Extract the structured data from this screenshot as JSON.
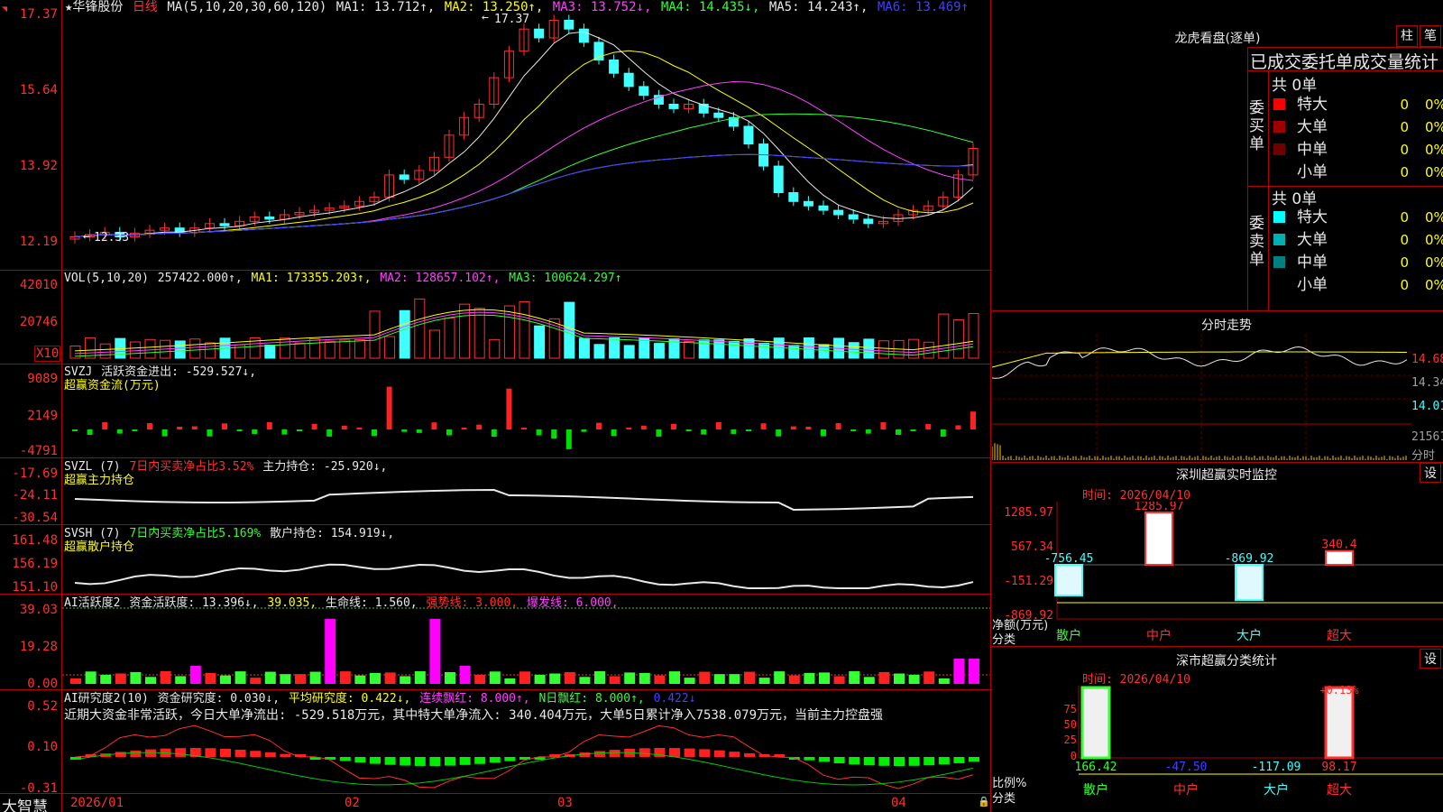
{
  "main": {
    "flag_icon": "arrow-icon",
    "stock_name": "★华锋股份",
    "period": "日线",
    "ma_params": "MA(5,10,20,30,60,120)",
    "ma1": "MA1: 13.712↑,",
    "ma2": "MA2: 13.250↑,",
    "ma3": "MA3: 13.752↓,",
    "ma4": "MA4: 14.435↓,",
    "ma5": "MA5: 14.243↑,",
    "ma6": "MA6: 13.469↑",
    "high_label": "17.37",
    "low_label": "12.33",
    "y_labels": [
      "17.37",
      "15.64",
      "13.92",
      "12.19"
    ]
  },
  "vol": {
    "params": "VOL(5,10,20)",
    "value": "257422.000↑,",
    "ma1": "MA1: 173355.203↑,",
    "ma2": "MA2: 128657.102↑,",
    "ma3": "MA3: 100624.297↑",
    "unit": "X10",
    "y_labels": [
      "42010",
      "20746"
    ]
  },
  "svzj": {
    "name": "SVZJ",
    "label": "活跃资金进出: -529.527↓,",
    "sub": "超赢资金流(万元)",
    "y_labels": [
      "9089",
      "2149",
      "-4791"
    ]
  },
  "svzl": {
    "name": "SVZL (7)",
    "pct": "7日内买卖净占比3.52%",
    "hold": "主力持仓: -25.920↓,",
    "sub": "超赢主力持仓",
    "y_labels": [
      "-17.69",
      "-24.11",
      "-30.54"
    ]
  },
  "svsh": {
    "name": "SVSH (7)",
    "pct": "7日内买卖净占比5.169%",
    "hold": "散户持仓: 154.919↓,",
    "sub": "超赢散户持仓",
    "y_labels": [
      "161.48",
      "156.19",
      "151.10"
    ]
  },
  "ai_active": {
    "name": "AI活跃度2",
    "v1": "资金活跃度: 13.396↓,",
    "v2": "39.035,",
    "v3": "生命线: 1.560,",
    "v4": "强势线: 3.000,",
    "v5": "爆发线: 6.000,",
    "y_labels": [
      "39.03",
      "19.28",
      "0.00"
    ]
  },
  "ai_research": {
    "name": "AI研究度2(10)",
    "v1": "资金研究度: 0.030↓,",
    "v2": "平均研究度: 0.422↓,",
    "v3": "连续飘红: 8.000↑,",
    "v4": "N日飘红: 8.000↑,",
    "v5": "0.422↓",
    "comment": "近期大资金非常活跃，今日大单净流出: -529.518万元，其中特大单净流入: 340.404万元，大单5日累计净入7538.079万元，当前主力控盘强",
    "y_labels": [
      "0.52",
      "0.10",
      "-0.31"
    ]
  },
  "bottom_bar": {
    "brand": "大智慧",
    "dates": [
      "2026/01",
      "02",
      "03",
      "04"
    ]
  },
  "dragon_tiger": {
    "title": "龙虎看盘(逐单)",
    "btn1": "柱",
    "btn2": "笔",
    "heading": "已成交委托单成交量统计",
    "buy_label": "委买单",
    "buy_total": "共 0单",
    "sell_label": "委卖单",
    "sell_total": "共 0单",
    "rows_buy": [
      {
        "name": "特大",
        "v1": "0",
        "v2": "0%",
        "color": "#ff0000"
      },
      {
        "name": "大单",
        "v1": "0",
        "v2": "0%",
        "color": "#a00000"
      },
      {
        "name": "中单",
        "v1": "0",
        "v2": "0%",
        "color": "#700000"
      },
      {
        "name": "小单",
        "v1": "0",
        "v2": "0%",
        "color": "#000000"
      }
    ],
    "rows_sell": [
      {
        "name": "特大",
        "v1": "0",
        "v2": "0%",
        "color": "#00ffff"
      },
      {
        "name": "大单",
        "v1": "0",
        "v2": "0%",
        "color": "#00b0b0"
      },
      {
        "name": "中单",
        "v1": "0",
        "v2": "0%",
        "color": "#008080"
      },
      {
        "name": "小单",
        "v1": "0",
        "v2": "0%",
        "color": "#000000"
      }
    ]
  },
  "intraday": {
    "title": "分时走势",
    "price_labels": [
      "14.68",
      "14.34",
      "14.01"
    ],
    "vol_label": "21561",
    "sub_label": "分时"
  },
  "sz_monitor": {
    "title": "深圳超赢实时监控",
    "btn": "设",
    "time": "时间: 2026/04/10",
    "y_labels": [
      "1285.97",
      "567.34",
      "-151.29",
      "-869.92"
    ],
    "axis_title1": "净额(万元)",
    "axis_title2": "分类",
    "categories": [
      "散户",
      "中户",
      "大户",
      "超大"
    ],
    "values": [
      -756.45,
      1285.97,
      -869.92,
      340.4
    ],
    "value_labels": [
      "-756.45",
      "1285.97",
      "-869.92",
      "340.4"
    ]
  },
  "sz_class": {
    "title": "深市超赢分类统计",
    "btn": "设",
    "time": "时间: 2026/04/10",
    "y_labels": [
      "75",
      "50",
      "25",
      "0"
    ],
    "axis_title1": "比例%",
    "axis_title2": "分类",
    "categories": [
      "散户",
      "中户",
      "大户",
      "超大"
    ],
    "bottom_values": [
      "166.42",
      "-47.50",
      "-117.09",
      "98.17"
    ],
    "top_label": "+0.13%"
  }
}
